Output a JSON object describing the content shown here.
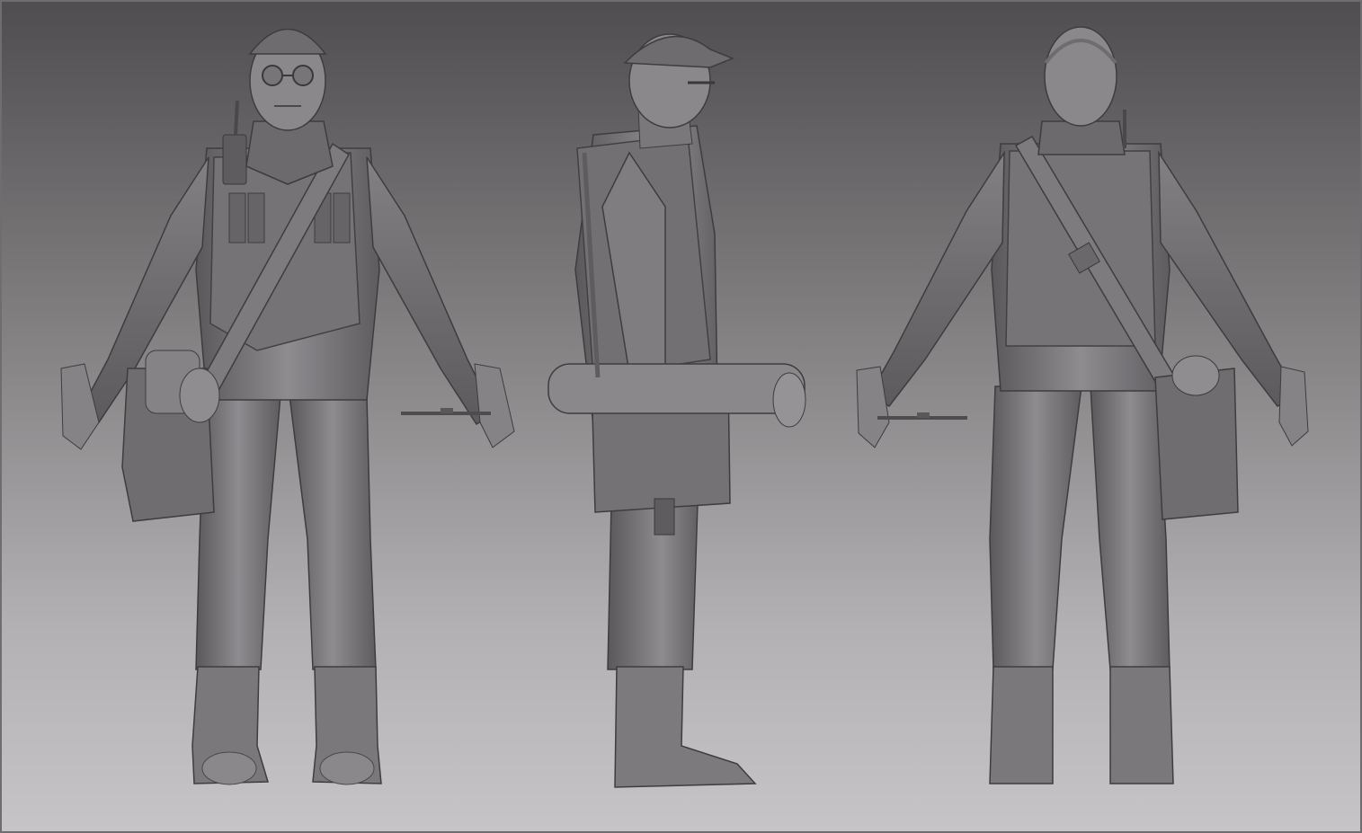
{
  "scene": {
    "colors": {
      "bg_top": "#4f4d4f",
      "bg_bottom": "#c7c4c7",
      "clay_light": "#8d8b8e",
      "clay_mid": "#6e6c6f",
      "clay_dark": "#4a484b",
      "clay_shadow": "#3a383b"
    },
    "views": [
      {
        "id": "front",
        "subject": "character-sculpt-front-view"
      },
      {
        "id": "side",
        "subject": "character-sculpt-side-view"
      },
      {
        "id": "back",
        "subject": "character-sculpt-back-view"
      }
    ]
  }
}
